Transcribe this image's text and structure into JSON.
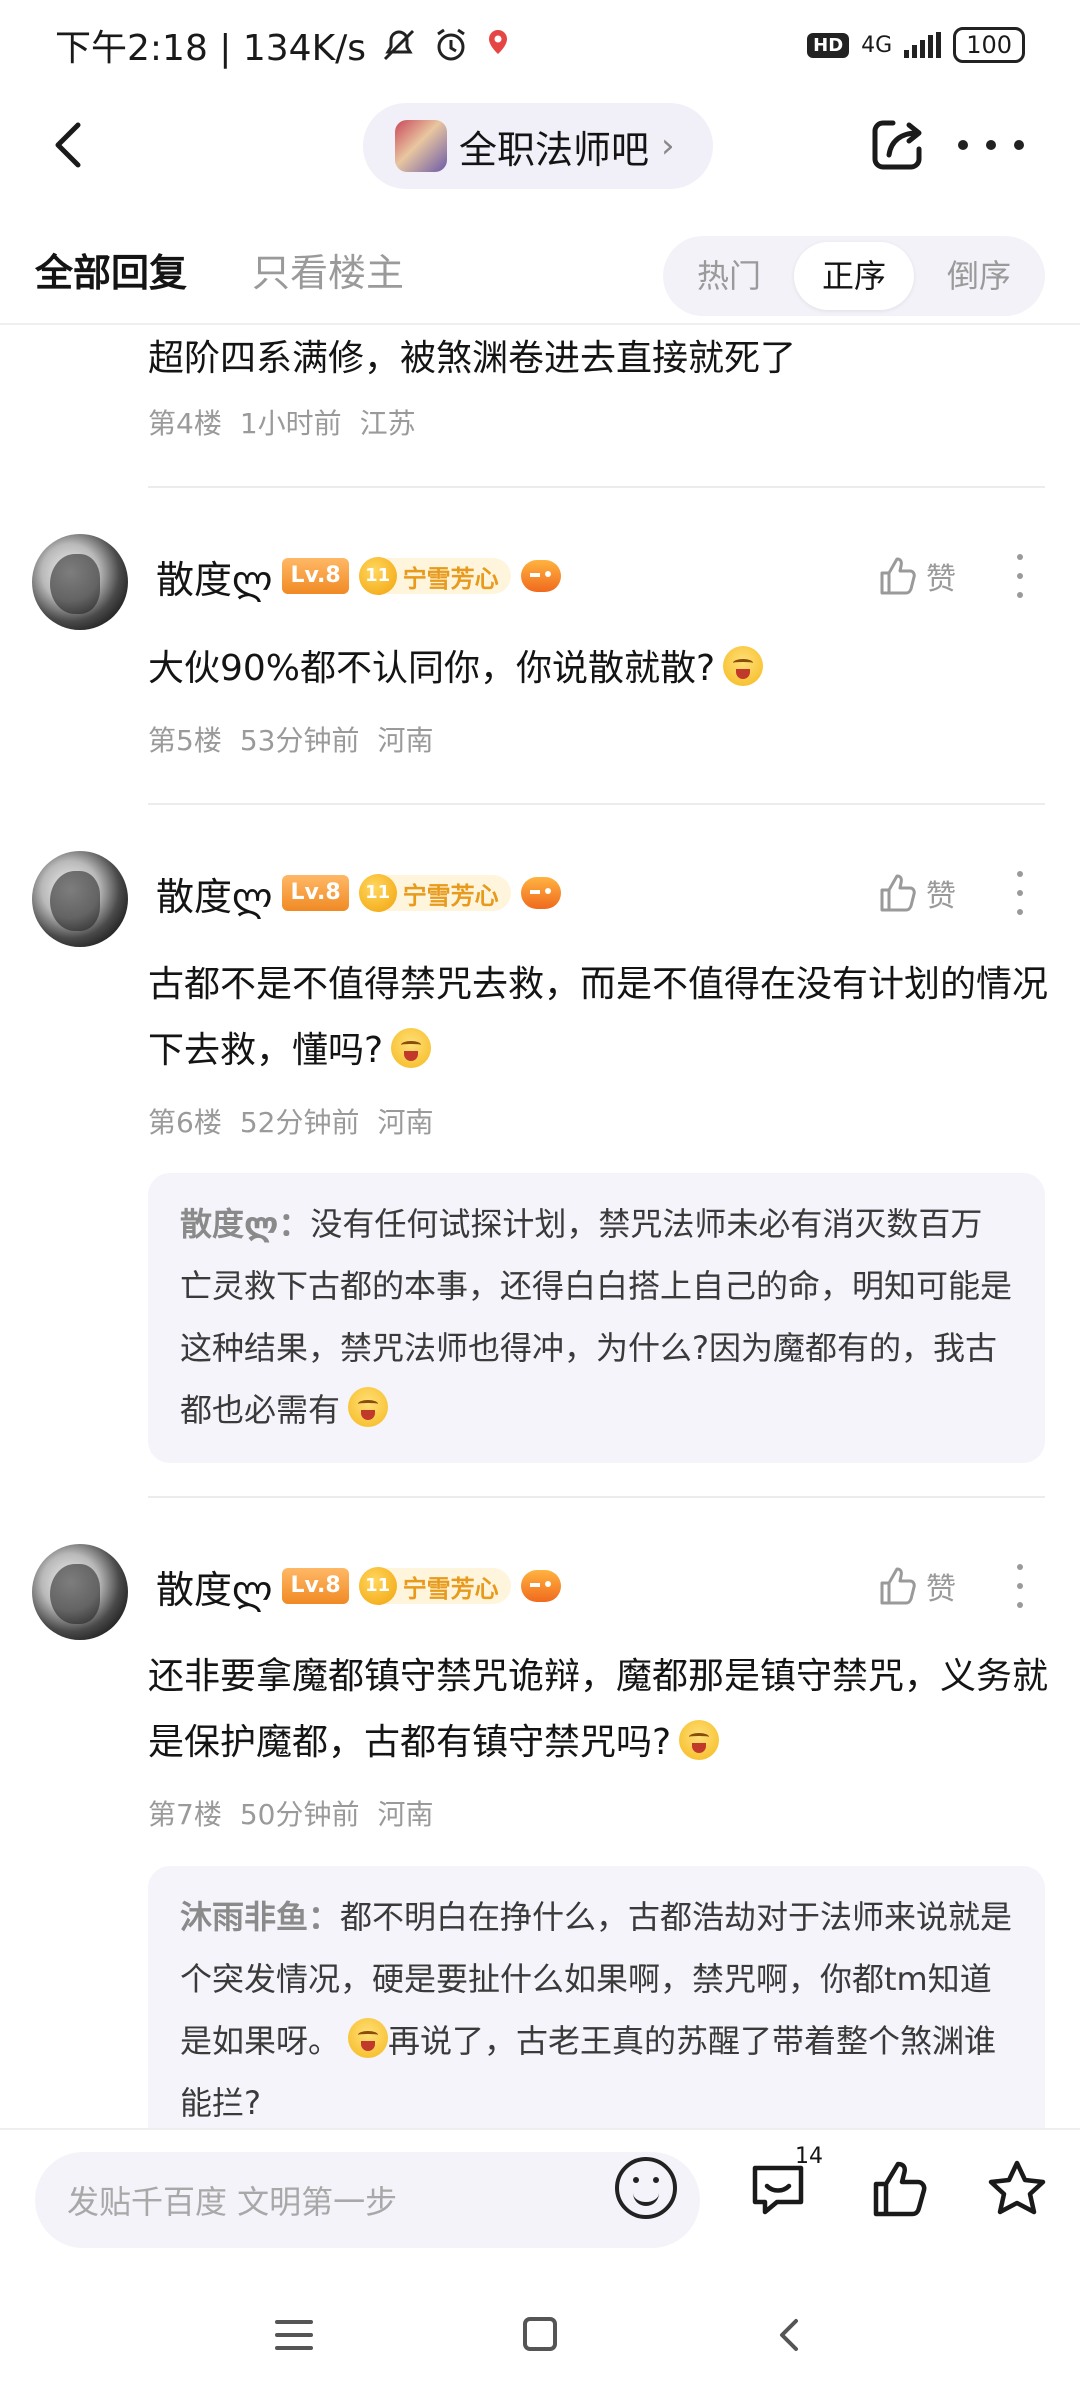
{
  "status_bar": {
    "time_speed": "下午2:18 | 134K/s",
    "network": "4G",
    "hd": "HD",
    "battery": "100"
  },
  "header": {
    "forum_name": "全职法师吧",
    "forum_chevron": "›"
  },
  "tabs": {
    "all_replies": "全部回复",
    "op_only": "只看楼主",
    "sort": {
      "hot": "热门",
      "asc": "正序",
      "desc": "倒序",
      "active": "asc"
    }
  },
  "feed": {
    "partial_post": {
      "text": "超阶四系满修，被煞渊卷进去直接就死了",
      "floor": "第4楼",
      "time": "1小时前",
      "location": "江苏"
    },
    "posts": [
      {
        "username": "散度ლ",
        "level": "Lv.8",
        "fan_level": "11",
        "fan_name": "宁雪芳心",
        "like_label": "赞",
        "text": "大伙90%都不认同你，你说散就散?",
        "floor": "第5楼",
        "time": "53分钟前",
        "location": "河南"
      },
      {
        "username": "散度ლ",
        "level": "Lv.8",
        "fan_level": "11",
        "fan_name": "宁雪芳心",
        "like_label": "赞",
        "text": "古都不是不值得禁咒去救，而是不值得在没有计划的情况下去救，懂吗?",
        "floor": "第6楼",
        "time": "52分钟前",
        "location": "河南",
        "quote": {
          "author": "散度ლ：",
          "text": "没有任何试探计划，禁咒法师未必有消灭数百万亡灵救下古都的本事，还得白白搭上自己的命，明知可能是这种结果，禁咒法师也得冲，为什么?因为魔都有的，我古都也必需有"
        }
      },
      {
        "username": "散度ლ",
        "level": "Lv.8",
        "fan_level": "11",
        "fan_name": "宁雪芳心",
        "like_label": "赞",
        "text": "还非要拿魔都镇守禁咒诡辩，魔都那是镇守禁咒，义务就是保护魔都，古都有镇守禁咒吗?",
        "floor": "第7楼",
        "time": "50分钟前",
        "location": "河南",
        "quote": {
          "author": "沐雨非鱼：",
          "text_before_emoji": "都不明白在挣什么，古都浩劫对于法师来说就是个突发情况，硬是要扯什么如果啊，禁咒啊，你都tm知道是如果呀。",
          "text_after_emoji": "再说了，古老王真的苏醒了带着整个煞渊谁能拦?"
        }
      }
    ]
  },
  "input_bar": {
    "placeholder": "发贴千百度 文明第一步",
    "comment_count": "14"
  },
  "icons": {
    "back": "chevron-left-icon",
    "share": "share-icon",
    "more": "more-horizontal-icon",
    "like": "thumbs-up-icon",
    "emoji": "emoji-icon",
    "comment": "comment-icon",
    "star": "star-icon"
  },
  "colors": {
    "accent_bg": "#f3f2f8",
    "level_badge": "#f08a24",
    "fan_badge_text": "#e79a1b",
    "meta_text": "#9a9a9a"
  }
}
